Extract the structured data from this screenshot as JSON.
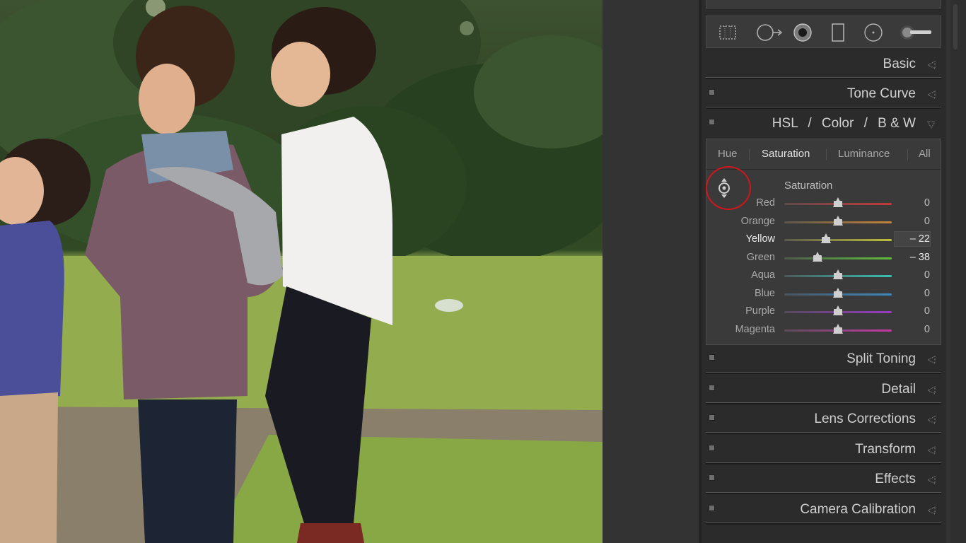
{
  "photo": {
    "description_none": ""
  },
  "tools": [
    {
      "name": "crop-overlay-icon"
    },
    {
      "name": "spot-removal-icon"
    },
    {
      "name": "red-eye-icon"
    },
    {
      "name": "graduated-filter-icon"
    },
    {
      "name": "radial-filter-icon"
    },
    {
      "name": "adjustment-brush-icon"
    }
  ],
  "sections": {
    "basic": "Basic",
    "tone_curve": "Tone Curve",
    "hsl": "HSL",
    "color": "Color",
    "bw": "B & W",
    "slash": "/",
    "split_toning": "Split Toning",
    "detail": "Detail",
    "lens_corrections": "Lens Corrections",
    "transform": "Transform",
    "effects": "Effects",
    "camera_calibration": "Camera Calibration"
  },
  "hsl": {
    "tabs": [
      "Hue",
      "Saturation",
      "Luminance",
      "All"
    ],
    "active_tab": "Saturation",
    "group_title": "Saturation",
    "sliders": [
      {
        "label": "Red",
        "value": "0",
        "num": 0,
        "colors": [
          "#5d4a4a",
          "#c23a3a"
        ]
      },
      {
        "label": "Orange",
        "value": "0",
        "num": 0,
        "colors": [
          "#5d554a",
          "#c2823a"
        ]
      },
      {
        "label": "Yellow",
        "value": "– 22",
        "num": -22,
        "colors": [
          "#5b5b4a",
          "#bdbf3a"
        ],
        "highlight": true
      },
      {
        "label": "Green",
        "value": "– 38",
        "num": -38,
        "colors": [
          "#4e5b4a",
          "#5ebf3a"
        ],
        "edited": true
      },
      {
        "label": "Aqua",
        "value": "0",
        "num": 0,
        "colors": [
          "#4a5b5a",
          "#3abfb4"
        ]
      },
      {
        "label": "Blue",
        "value": "0",
        "num": 0,
        "colors": [
          "#4a545d",
          "#3a8ac2"
        ]
      },
      {
        "label": "Purple",
        "value": "0",
        "num": 0,
        "colors": [
          "#544a5d",
          "#9a3ac2"
        ]
      },
      {
        "label": "Magenta",
        "value": "0",
        "num": 0,
        "colors": [
          "#5d4a58",
          "#c23aa6"
        ]
      }
    ]
  },
  "colors": {
    "highlight_ring": "#d0161c",
    "panel_bg": "#2b2b2b"
  }
}
